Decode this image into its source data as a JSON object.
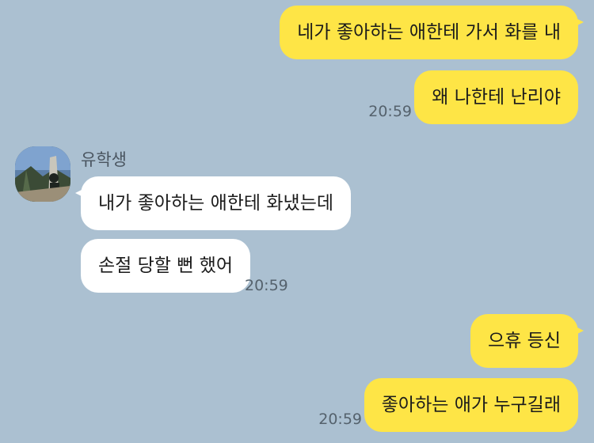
{
  "messages": [
    {
      "side": "mine",
      "text": "네가 좋아하는 애한테 가서 화를 내"
    },
    {
      "side": "mine",
      "text": "왜 나한테 난리야",
      "time": "20:59"
    },
    {
      "sender": "유학생",
      "side": "theirs",
      "text": "내가 좋아하는 애한테 화냈는데"
    },
    {
      "side": "theirs",
      "text": "손절 당할 뻔 했어",
      "time": "20:59"
    },
    {
      "side": "mine",
      "text": "으휴 등신"
    },
    {
      "side": "mine",
      "text": "좋아하는 애가 누구길래",
      "time": "20:59"
    }
  ],
  "colors": {
    "background": "#abc0d1",
    "my_bubble": "#fee546",
    "their_bubble": "#ffffff",
    "timestamp": "#55626d"
  },
  "icons": {
    "avatar": "profile-photo-outdoor-tree"
  }
}
